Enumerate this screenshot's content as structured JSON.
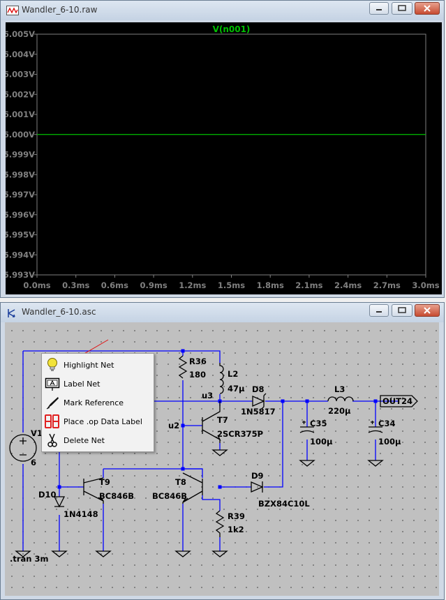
{
  "waveform_window": {
    "title": "Wandler_6-10.raw",
    "trace_label": "V(n001)",
    "trace_color": "#00c000",
    "y_tick_labels": [
      "6.005V",
      "6.004V",
      "6.003V",
      "6.002V",
      "6.001V",
      "6.000V",
      "5.999V",
      "5.998V",
      "5.997V",
      "5.996V",
      "5.995V",
      "5.994V",
      "5.993V"
    ],
    "x_tick_labels": [
      "0.0ms",
      "0.3ms",
      "0.6ms",
      "0.9ms",
      "1.2ms",
      "1.5ms",
      "1.8ms",
      "2.1ms",
      "2.4ms",
      "2.7ms",
      "3.0ms"
    ],
    "trace_value_v": 6.0
  },
  "schematic_window": {
    "title": "Wandler_6-10.asc",
    "labels": {
      "r36": "R36",
      "r36_val": "180",
      "l2": "L2",
      "l2_val": "47µ",
      "u3": "u3",
      "u2": "u2",
      "d8": "D8",
      "d8_val": "1N5817",
      "l3": "L3",
      "l3_val": "220µ",
      "out": "OUT24",
      "t7": "T7",
      "t7_val": "2SCR375P",
      "c35": "C35",
      "c35_val": "100µ",
      "c34": "C34",
      "c34_val": "100µ",
      "v1": "V1",
      "v1_val": "6",
      "t9": "T9",
      "t9_val": "BC846B",
      "t8": "T8",
      "t8_val": "BC846B",
      "d10": "D10",
      "d10_val": "1N4148",
      "d9": "D9",
      "d9_val": "BZX84C10L",
      "r39": "R39",
      "r39_val": "1k2",
      "tran": ".tran 3m"
    }
  },
  "context_menu": {
    "items": [
      {
        "label": "Highlight Net",
        "icon": "lightbulb-icon"
      },
      {
        "label": "Label Net",
        "icon": "label-net-icon"
      },
      {
        "label": "Mark Reference",
        "icon": "mark-reference-icon"
      },
      {
        "label": "Place .op Data Label",
        "icon": "op-data-label-icon"
      },
      {
        "label": "Delete Net",
        "icon": "scissors-icon"
      }
    ]
  },
  "colors": {
    "wire": "#0000ff",
    "plot_background": "#000000",
    "plot_grid": "#808080",
    "schematic_background": "#c0c0c0"
  }
}
